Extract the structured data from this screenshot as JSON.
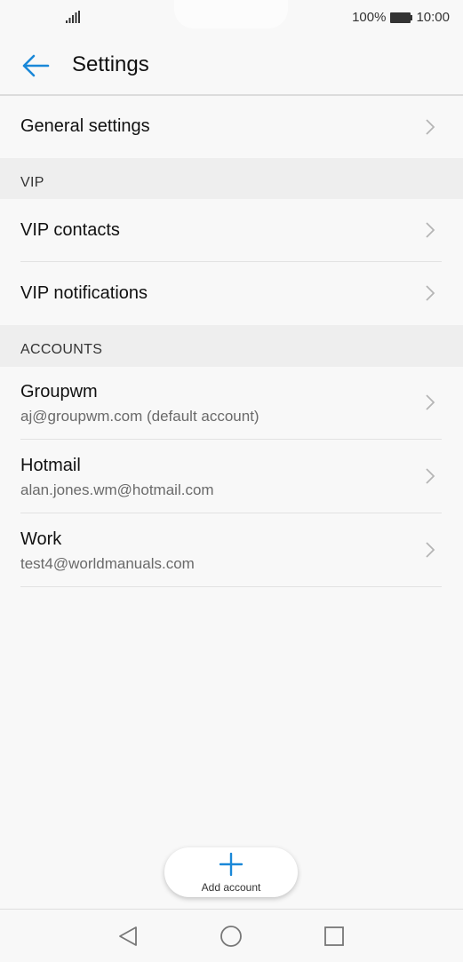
{
  "status_bar": {
    "battery": "100%",
    "time": "10:00"
  },
  "header": {
    "title": "Settings"
  },
  "general": {
    "label": "General settings"
  },
  "vip": {
    "section": "VIP",
    "items": [
      {
        "label": "VIP contacts"
      },
      {
        "label": "VIP notifications"
      }
    ]
  },
  "accounts": {
    "section": "ACCOUNTS",
    "items": [
      {
        "name": "Groupwm",
        "email": "aj@groupwm.com (default account)"
      },
      {
        "name": "Hotmail",
        "email": "alan.jones.wm@hotmail.com"
      },
      {
        "name": "Work",
        "email": "test4@worldmanuals.com"
      }
    ]
  },
  "fab": {
    "label": "Add account"
  },
  "icons": {
    "back": "arrow-left-icon",
    "chevron": "chevron-right-icon",
    "add": "plus-icon",
    "nav_back": "triangle-back-icon",
    "nav_home": "circle-home-icon",
    "nav_recent": "square-recents-icon"
  },
  "colors": {
    "accent": "#1a88d8",
    "background": "#f8f8f8",
    "section_bg": "#eeeeee"
  }
}
